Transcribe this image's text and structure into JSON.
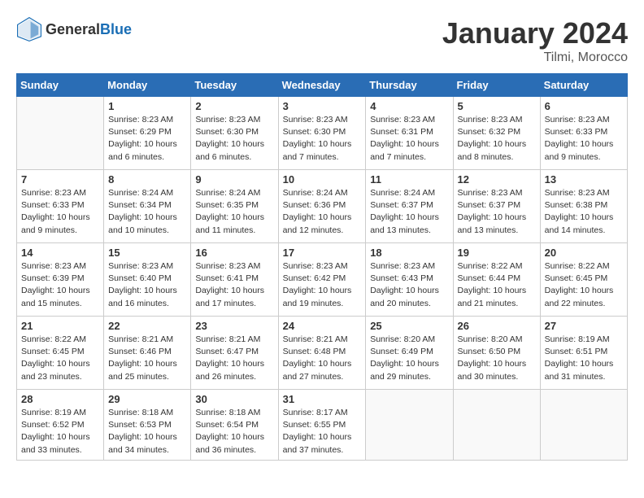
{
  "header": {
    "logo_general": "General",
    "logo_blue": "Blue",
    "month_title": "January 2024",
    "location": "Tilmi, Morocco"
  },
  "weekdays": [
    "Sunday",
    "Monday",
    "Tuesday",
    "Wednesday",
    "Thursday",
    "Friday",
    "Saturday"
  ],
  "weeks": [
    [
      {
        "day": "",
        "info": ""
      },
      {
        "day": "1",
        "info": "Sunrise: 8:23 AM\nSunset: 6:29 PM\nDaylight: 10 hours\nand 6 minutes."
      },
      {
        "day": "2",
        "info": "Sunrise: 8:23 AM\nSunset: 6:30 PM\nDaylight: 10 hours\nand 6 minutes."
      },
      {
        "day": "3",
        "info": "Sunrise: 8:23 AM\nSunset: 6:30 PM\nDaylight: 10 hours\nand 7 minutes."
      },
      {
        "day": "4",
        "info": "Sunrise: 8:23 AM\nSunset: 6:31 PM\nDaylight: 10 hours\nand 7 minutes."
      },
      {
        "day": "5",
        "info": "Sunrise: 8:23 AM\nSunset: 6:32 PM\nDaylight: 10 hours\nand 8 minutes."
      },
      {
        "day": "6",
        "info": "Sunrise: 8:23 AM\nSunset: 6:33 PM\nDaylight: 10 hours\nand 9 minutes."
      }
    ],
    [
      {
        "day": "7",
        "info": "Sunrise: 8:23 AM\nSunset: 6:33 PM\nDaylight: 10 hours\nand 9 minutes."
      },
      {
        "day": "8",
        "info": "Sunrise: 8:24 AM\nSunset: 6:34 PM\nDaylight: 10 hours\nand 10 minutes."
      },
      {
        "day": "9",
        "info": "Sunrise: 8:24 AM\nSunset: 6:35 PM\nDaylight: 10 hours\nand 11 minutes."
      },
      {
        "day": "10",
        "info": "Sunrise: 8:24 AM\nSunset: 6:36 PM\nDaylight: 10 hours\nand 12 minutes."
      },
      {
        "day": "11",
        "info": "Sunrise: 8:24 AM\nSunset: 6:37 PM\nDaylight: 10 hours\nand 13 minutes."
      },
      {
        "day": "12",
        "info": "Sunrise: 8:23 AM\nSunset: 6:37 PM\nDaylight: 10 hours\nand 13 minutes."
      },
      {
        "day": "13",
        "info": "Sunrise: 8:23 AM\nSunset: 6:38 PM\nDaylight: 10 hours\nand 14 minutes."
      }
    ],
    [
      {
        "day": "14",
        "info": "Sunrise: 8:23 AM\nSunset: 6:39 PM\nDaylight: 10 hours\nand 15 minutes."
      },
      {
        "day": "15",
        "info": "Sunrise: 8:23 AM\nSunset: 6:40 PM\nDaylight: 10 hours\nand 16 minutes."
      },
      {
        "day": "16",
        "info": "Sunrise: 8:23 AM\nSunset: 6:41 PM\nDaylight: 10 hours\nand 17 minutes."
      },
      {
        "day": "17",
        "info": "Sunrise: 8:23 AM\nSunset: 6:42 PM\nDaylight: 10 hours\nand 19 minutes."
      },
      {
        "day": "18",
        "info": "Sunrise: 8:23 AM\nSunset: 6:43 PM\nDaylight: 10 hours\nand 20 minutes."
      },
      {
        "day": "19",
        "info": "Sunrise: 8:22 AM\nSunset: 6:44 PM\nDaylight: 10 hours\nand 21 minutes."
      },
      {
        "day": "20",
        "info": "Sunrise: 8:22 AM\nSunset: 6:45 PM\nDaylight: 10 hours\nand 22 minutes."
      }
    ],
    [
      {
        "day": "21",
        "info": "Sunrise: 8:22 AM\nSunset: 6:45 PM\nDaylight: 10 hours\nand 23 minutes."
      },
      {
        "day": "22",
        "info": "Sunrise: 8:21 AM\nSunset: 6:46 PM\nDaylight: 10 hours\nand 25 minutes."
      },
      {
        "day": "23",
        "info": "Sunrise: 8:21 AM\nSunset: 6:47 PM\nDaylight: 10 hours\nand 26 minutes."
      },
      {
        "day": "24",
        "info": "Sunrise: 8:21 AM\nSunset: 6:48 PM\nDaylight: 10 hours\nand 27 minutes."
      },
      {
        "day": "25",
        "info": "Sunrise: 8:20 AM\nSunset: 6:49 PM\nDaylight: 10 hours\nand 29 minutes."
      },
      {
        "day": "26",
        "info": "Sunrise: 8:20 AM\nSunset: 6:50 PM\nDaylight: 10 hours\nand 30 minutes."
      },
      {
        "day": "27",
        "info": "Sunrise: 8:19 AM\nSunset: 6:51 PM\nDaylight: 10 hours\nand 31 minutes."
      }
    ],
    [
      {
        "day": "28",
        "info": "Sunrise: 8:19 AM\nSunset: 6:52 PM\nDaylight: 10 hours\nand 33 minutes."
      },
      {
        "day": "29",
        "info": "Sunrise: 8:18 AM\nSunset: 6:53 PM\nDaylight: 10 hours\nand 34 minutes."
      },
      {
        "day": "30",
        "info": "Sunrise: 8:18 AM\nSunset: 6:54 PM\nDaylight: 10 hours\nand 36 minutes."
      },
      {
        "day": "31",
        "info": "Sunrise: 8:17 AM\nSunset: 6:55 PM\nDaylight: 10 hours\nand 37 minutes."
      },
      {
        "day": "",
        "info": ""
      },
      {
        "day": "",
        "info": ""
      },
      {
        "day": "",
        "info": ""
      }
    ]
  ]
}
